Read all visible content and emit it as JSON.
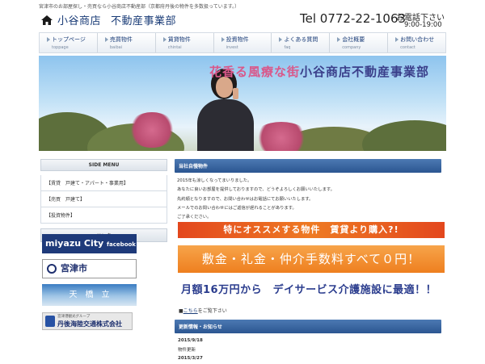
{
  "header": {
    "tagline": "宮津市のお部屋探し・売買なら小谷商店不動産部（京都府丹後の物件を多数扱っています。）",
    "logo_name": "小谷商店",
    "logo_dept": "不動産事業部",
    "tel": "Tel 0772-22-1063",
    "tel_label": "お電話下さい",
    "tel_hours": "9:00-19:00"
  },
  "nav": [
    {
      "jp": "トップページ",
      "en": "toppage"
    },
    {
      "jp": "売買物件",
      "en": "baibai"
    },
    {
      "jp": "賃貸物件",
      "en": "chintai"
    },
    {
      "jp": "投資物件",
      "en": "invest"
    },
    {
      "jp": "よくある質問",
      "en": "faq"
    },
    {
      "jp": "会社概要",
      "en": "company"
    },
    {
      "jp": "お問い合わせ",
      "en": "contact"
    }
  ],
  "hero": {
    "title_a": "花香る風療な街",
    "title_b": "小谷商店不動産事業部"
  },
  "sidebar": {
    "menu_title": "SIDE MENU",
    "items": [
      "【賃貸　戸建て・アパート・事業用】",
      "【売買　戸建て】",
      "【投資物件】"
    ],
    "link_title": "リンク",
    "banners": {
      "miyazu": "miyazu City",
      "miyazu_sub": "facebook",
      "city": "宮津市",
      "ama": "天　橋　立",
      "tango_small": "宮津港観光グループ",
      "tango": "丹後海陸交通株式会社"
    }
  },
  "main": {
    "section_title": "当社自慢物件",
    "greeting": [
      "2015年も涼しくなってまいりました。",
      "あなたに良いお部屋を提供しておりますので、どうぞよろしくお願いいたします。",
      "先約順となりますので、お問い合わせはお電話にてお願いいたします。",
      "メールでのお問い合わせにはご返信が遅れることがあります。",
      "ご了承ください。"
    ],
    "promo1": "特にオススメする物件　賃貸より購入?!",
    "promo2": "敷金・礼金・仲介手数料すべて０円！",
    "promo3": "月額16万円から　デイサービス介護施設に最適！！",
    "detail_bullet": "■",
    "detail_link": "こちら",
    "detail_text": "をご覧下さい",
    "news_title": "更新情報・お知らせ",
    "news": [
      {
        "date": "2015/9/18",
        "text": "物件更新"
      },
      {
        "date": "2015/3/27",
        "text": ""
      }
    ]
  },
  "colors": {
    "nav_text": "#1b3d78",
    "section_head": "#2c5691",
    "promo_orange": "#ee7a23",
    "hero_pink": "#d9588a",
    "hero_navy": "#3a3f8a"
  }
}
